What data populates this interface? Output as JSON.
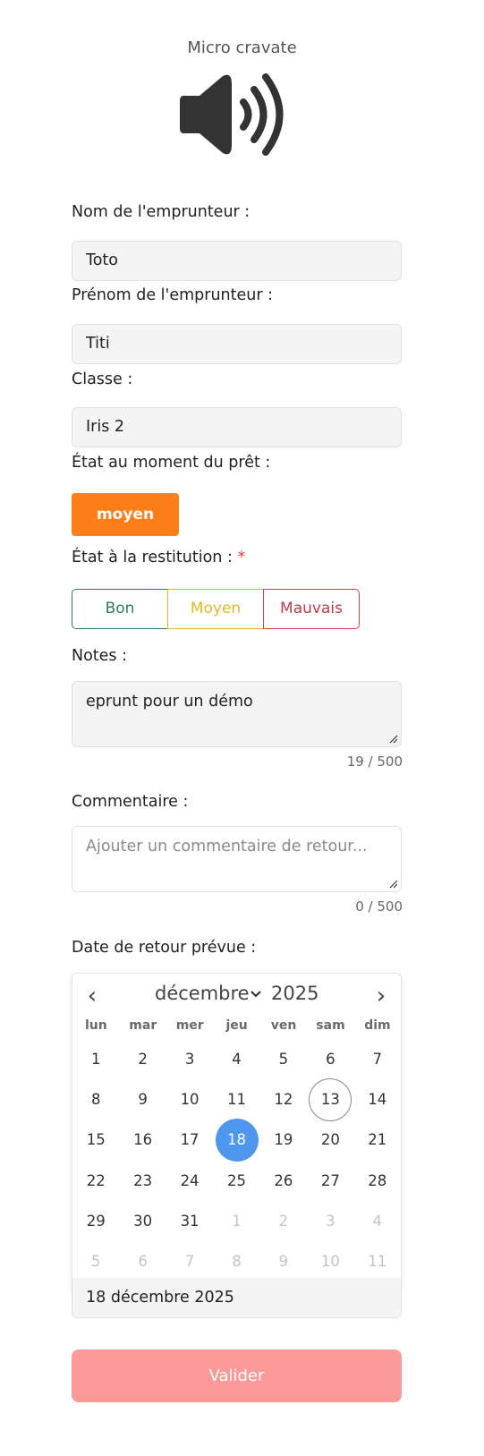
{
  "item": {
    "title": "Micro cravate",
    "icon": "speaker-volume-icon"
  },
  "form": {
    "nom": {
      "label": "Nom de l'emprunteur :",
      "value": "Toto"
    },
    "prenom": {
      "label": "Prénom de l'emprunteur :",
      "value": "Titi"
    },
    "classe": {
      "label": "Classe :",
      "value": "Iris 2"
    },
    "etat_pret": {
      "label": "État au moment du prêt :",
      "value": "moyen",
      "color": "#fd7f1a"
    },
    "etat_restitution": {
      "label": "État à la restitution :",
      "required_mark": "*",
      "options": [
        {
          "label": "Bon",
          "color": "#2f7d5e"
        },
        {
          "label": "Moyen",
          "color": "#e2b82a"
        },
        {
          "label": "Mauvais",
          "color": "#c03a4a"
        }
      ]
    },
    "notes": {
      "label": "Notes :",
      "value": "eprunt pour un démo",
      "counter": "19 / 500"
    },
    "commentaire": {
      "label": "Commentaire :",
      "placeholder": "Ajouter un commentaire de retour...",
      "counter": "0 / 500"
    },
    "date_retour": {
      "label": "Date de retour prévue :",
      "value": "18 décembre 2025",
      "calendar": {
        "month": "décembre",
        "year": "2025",
        "weekdays": [
          "lun",
          "mar",
          "mer",
          "jeu",
          "ven",
          "sam",
          "dim"
        ],
        "weeks": [
          [
            "1",
            "2",
            "3",
            "4",
            "5",
            "6",
            "7"
          ],
          [
            "8",
            "9",
            "10",
            "11",
            "12",
            "13",
            "14"
          ],
          [
            "15",
            "16",
            "17",
            "18",
            "19",
            "20",
            "21"
          ],
          [
            "22",
            "23",
            "24",
            "25",
            "26",
            "27",
            "28"
          ],
          [
            "29",
            "30",
            "31",
            "1",
            "2",
            "3",
            "4"
          ],
          [
            "5",
            "6",
            "7",
            "8",
            "9",
            "10",
            "11"
          ]
        ],
        "today": "13",
        "selected": "18",
        "accent": "#4f97ee"
      }
    },
    "submit_label": "Valider",
    "submit_color": "#fc9a98"
  }
}
